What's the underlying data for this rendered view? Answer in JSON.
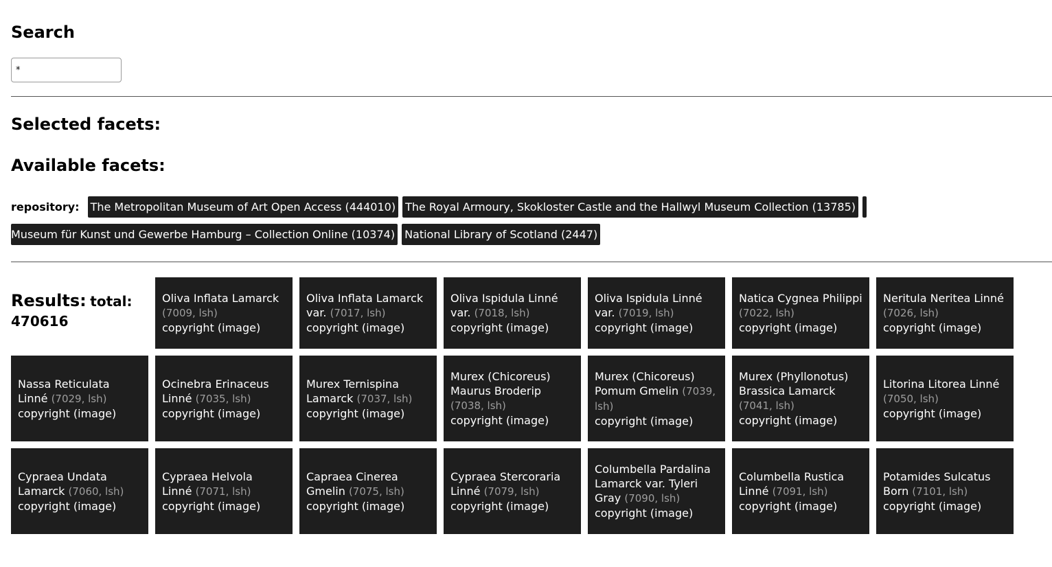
{
  "search": {
    "title": "Search",
    "value": "*"
  },
  "selected_facets": {
    "title": "Selected facets:"
  },
  "available_facets": {
    "title": "Available facets:",
    "facets": [
      {
        "label": "repository:",
        "values": [
          "The Metropolitan Museum of Art Open Access (444010)",
          "The Royal Armoury, Skokloster Castle and the Hallwyl Museum Collection (13785)",
          "Museum für Kunst und Gewerbe Hamburg – Collection Online (10374)",
          "National Library of Scotland (2447)"
        ]
      }
    ]
  },
  "results": {
    "title": "Results:",
    "total_label": "total:",
    "total": "470616",
    "copyright_label": "copyright (image)",
    "items": [
      {
        "name": "Oliva Inflata Lamarck",
        "meta": "(7009, lsh)"
      },
      {
        "name": "Oliva Inflata Lamarck var.",
        "meta": "(7017, lsh)"
      },
      {
        "name": "Oliva Ispidula Linné var.",
        "meta": "(7018, lsh)"
      },
      {
        "name": "Oliva Ispidula Linné var.",
        "meta": "(7019, lsh)"
      },
      {
        "name": "Natica Cygnea Philippi",
        "meta": "(7022, lsh)"
      },
      {
        "name": "Neritula Neritea Linné",
        "meta": "(7026, lsh)"
      },
      {
        "name": "Nassa Reticulata Linné",
        "meta": "(7029, lsh)"
      },
      {
        "name": "Ocinebra Erinaceus Linné",
        "meta": "(7035, lsh)"
      },
      {
        "name": "Murex Ternispina Lamarck",
        "meta": "(7037, lsh)"
      },
      {
        "name": "Murex (Chicoreus) Maurus Broderip",
        "meta": "(7038, lsh)"
      },
      {
        "name": "Murex (Chicoreus) Pomum Gmelin",
        "meta": "(7039, lsh)"
      },
      {
        "name": "Murex (Phyllonotus) Brassica Lamarck",
        "meta": "(7041, lsh)"
      },
      {
        "name": "Litorina Litorea Linné",
        "meta": "(7050, lsh)"
      },
      {
        "name": "Cypraea Undata Lamarck",
        "meta": "(7060, lsh)"
      },
      {
        "name": "Cypraea Helvola Linné",
        "meta": "(7071, lsh)"
      },
      {
        "name": "Capraea Cinerea Gmelin",
        "meta": "(7075, lsh)"
      },
      {
        "name": "Cypraea Stercoraria Linné",
        "meta": "(7079, lsh)"
      },
      {
        "name": "Columbella Pardalina Lamarck var. Tyleri Gray",
        "meta": "(7090, lsh)"
      },
      {
        "name": "Columbella Rustica Linné",
        "meta": "(7091, lsh)"
      },
      {
        "name": "Potamides Sulcatus Born",
        "meta": "(7101, lsh)"
      }
    ]
  }
}
